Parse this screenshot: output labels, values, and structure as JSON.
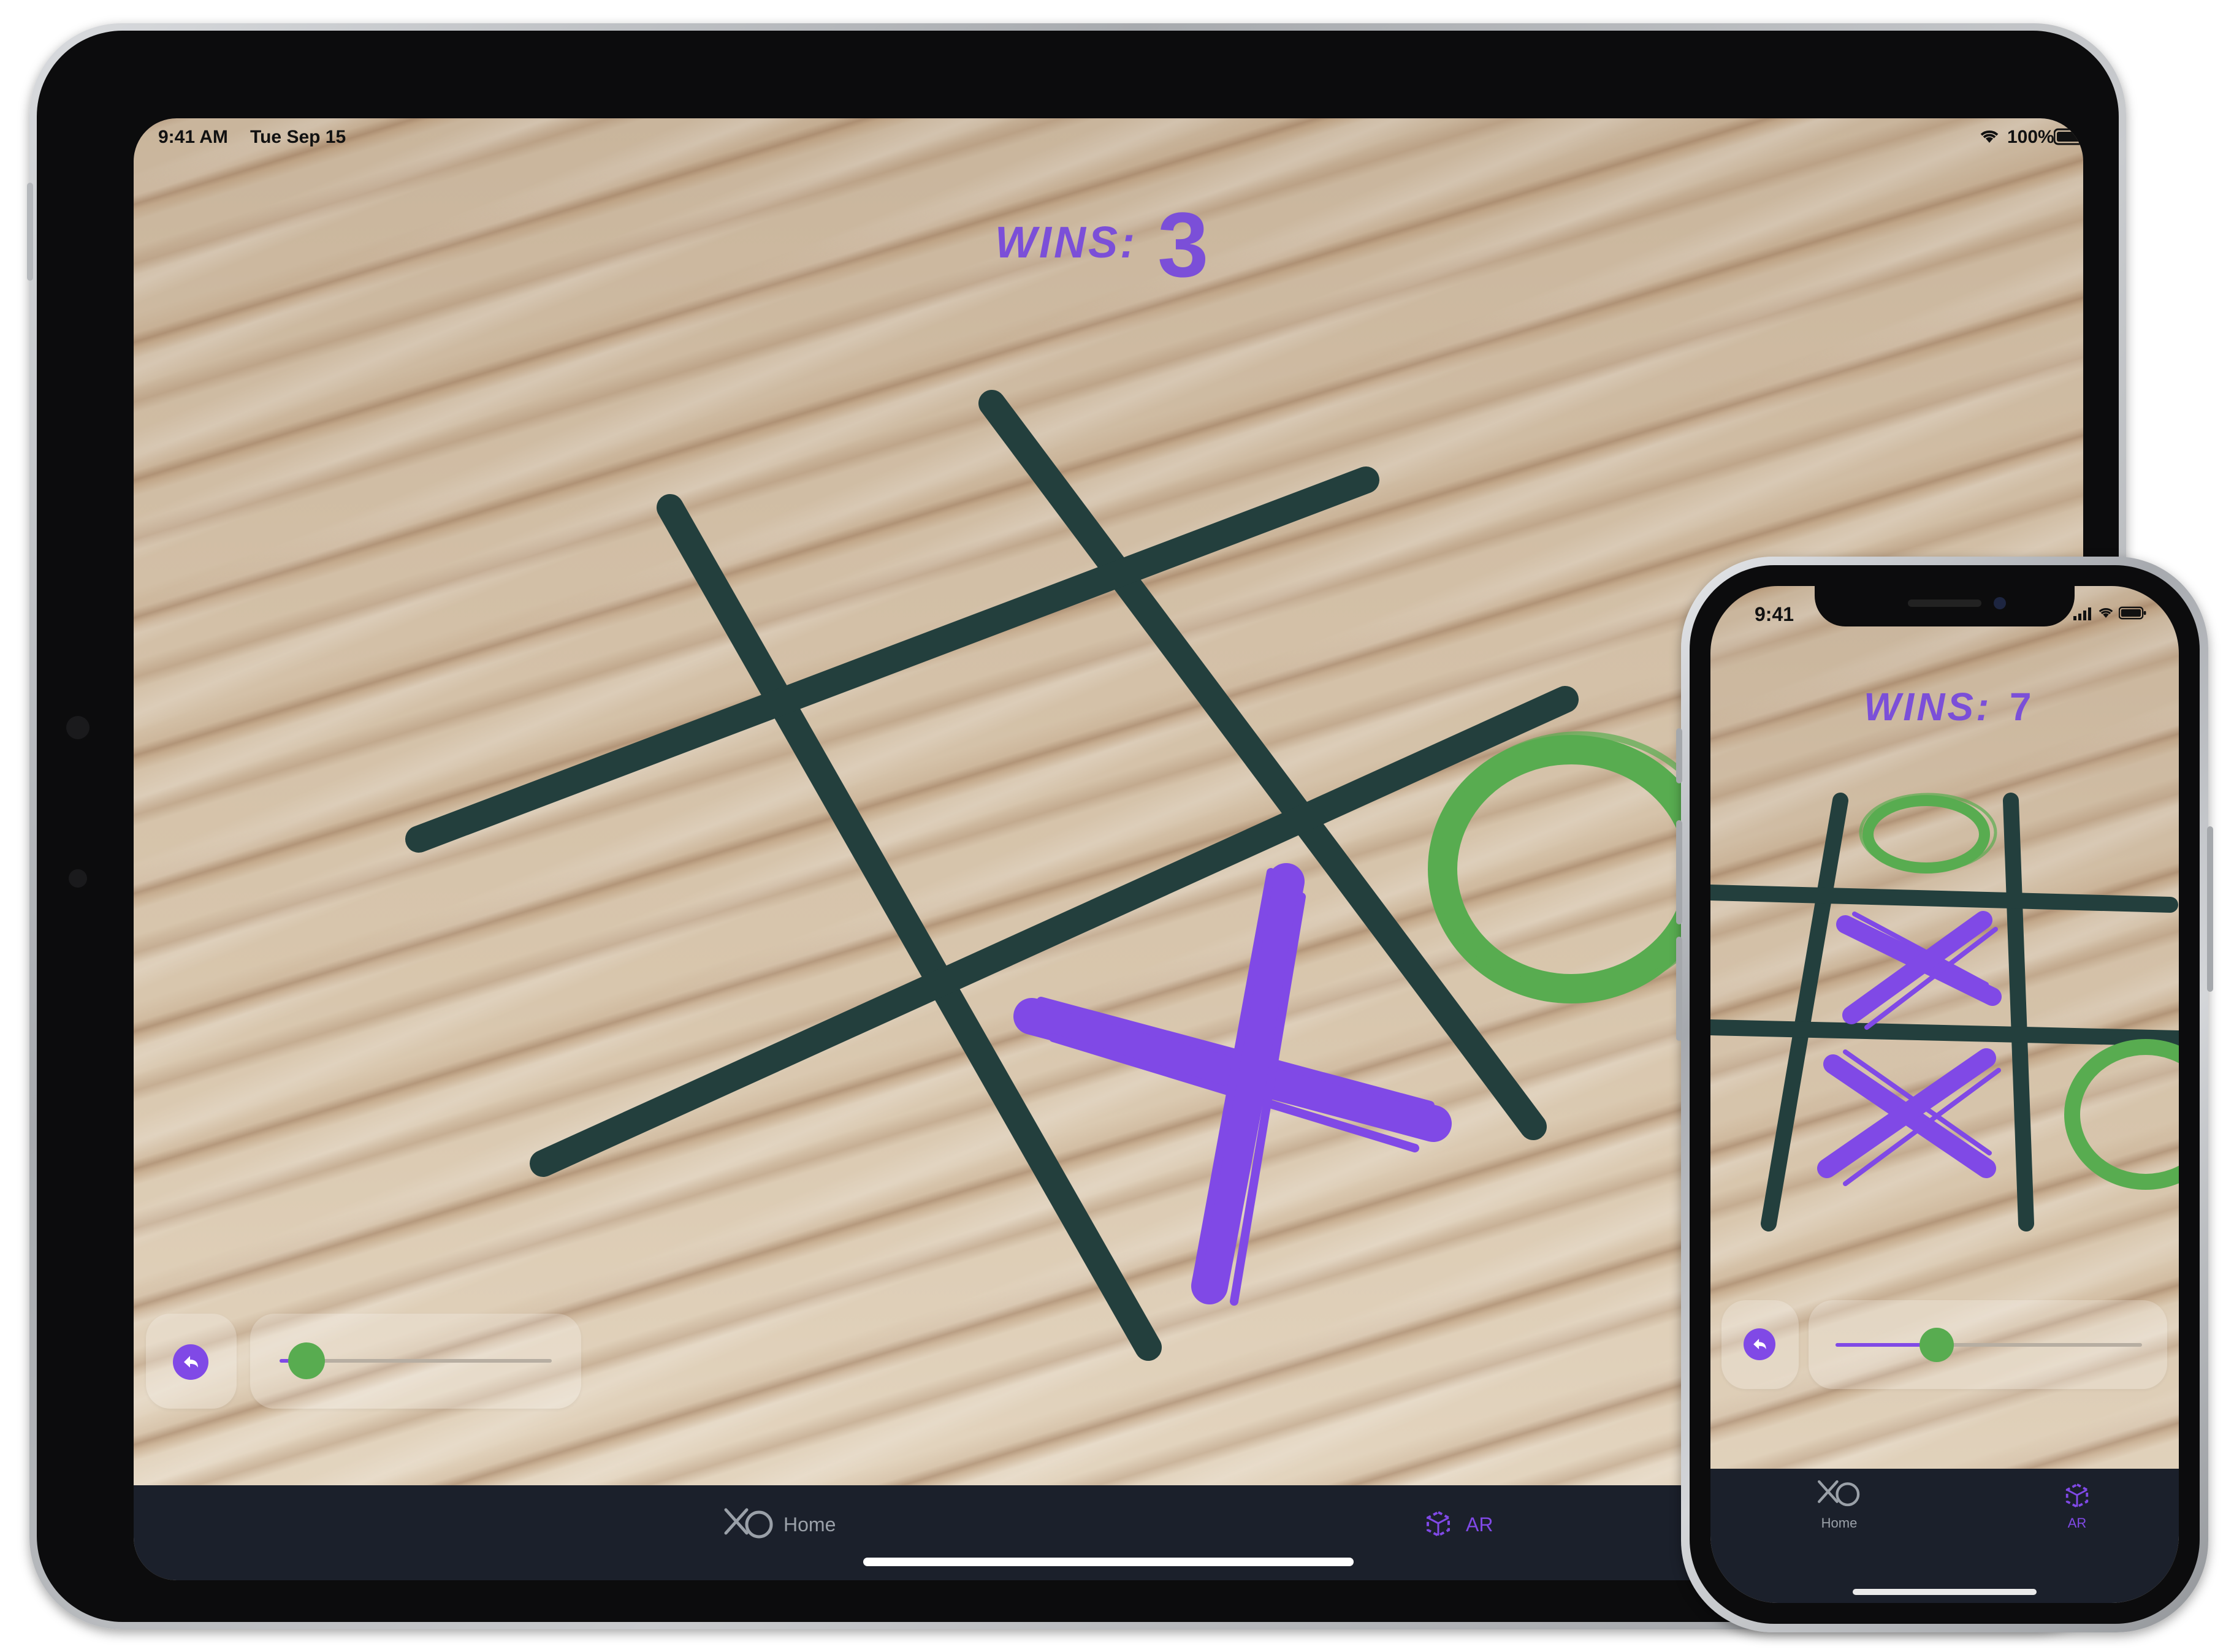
{
  "ipad": {
    "status": {
      "time": "9:41 AM",
      "date": "Tue Sep 15",
      "battery": "100%"
    },
    "wins_label": "WINS:",
    "wins_value": "3",
    "board": {
      "marks": [
        "X",
        "O"
      ]
    },
    "slider": {
      "value": 0.1
    },
    "tabs": [
      {
        "label": "Home",
        "icon": "xo-logo-icon",
        "active": false
      },
      {
        "label": "AR",
        "icon": "ar-cube-icon",
        "active": true
      }
    ]
  },
  "iphone": {
    "status": {
      "time": "9:41"
    },
    "wins_label": "WINS:",
    "wins_value": "7",
    "board": {
      "marks": [
        "O",
        "X",
        "X",
        "O"
      ]
    },
    "slider": {
      "value": 0.33
    },
    "tabs": [
      {
        "label": "Home",
        "icon": "xo-logo-icon",
        "active": false
      },
      {
        "label": "AR",
        "icon": "ar-cube-icon",
        "active": true
      }
    ]
  },
  "colors": {
    "purple": "#8049e6",
    "green": "#58ac50",
    "board_lines": "#233f3d",
    "tabbar": "#1b202b"
  }
}
